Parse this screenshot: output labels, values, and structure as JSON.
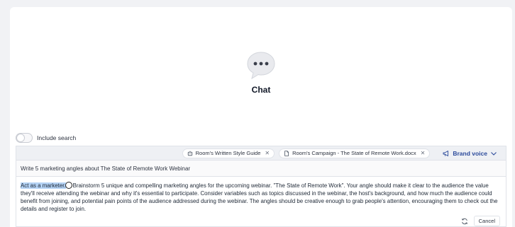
{
  "chat": {
    "title": "Chat"
  },
  "search_toggle": {
    "label": "Include search"
  },
  "context": {
    "chips": [
      {
        "label": "Room's Written Style Guide",
        "icon": "robot-icon"
      },
      {
        "label": "Room's Campaign - The State of Remote Work.docx",
        "icon": "document-icon"
      }
    ],
    "brand_voice": {
      "label": "Brand voice"
    }
  },
  "prompt": {
    "value": "Write 5 marketing angles about The State of Remote Work Webinar"
  },
  "result": {
    "highlight": "Act as a marketer.",
    "body": "Brainstorm 5 unique and compelling marketing angles for the upcoming webinar. \"The State of Remote Work\". Your angle should make it clear to the audience the value they'll receive attending the webinar and why it's essential to participate. Consider variables such as topics discussed in the webinar, the host's background, and how much the audience could benefit from joining, and potential pain points of the audience addressed during the webinar. The angles should be creative enough to grab people's attention, encouraging them to check out the details and register to join."
  },
  "actions": {
    "cancel_label": "Cancel"
  },
  "colors": {
    "brand_link": "#2b4a9b",
    "highlight": "#b5d3f5"
  }
}
